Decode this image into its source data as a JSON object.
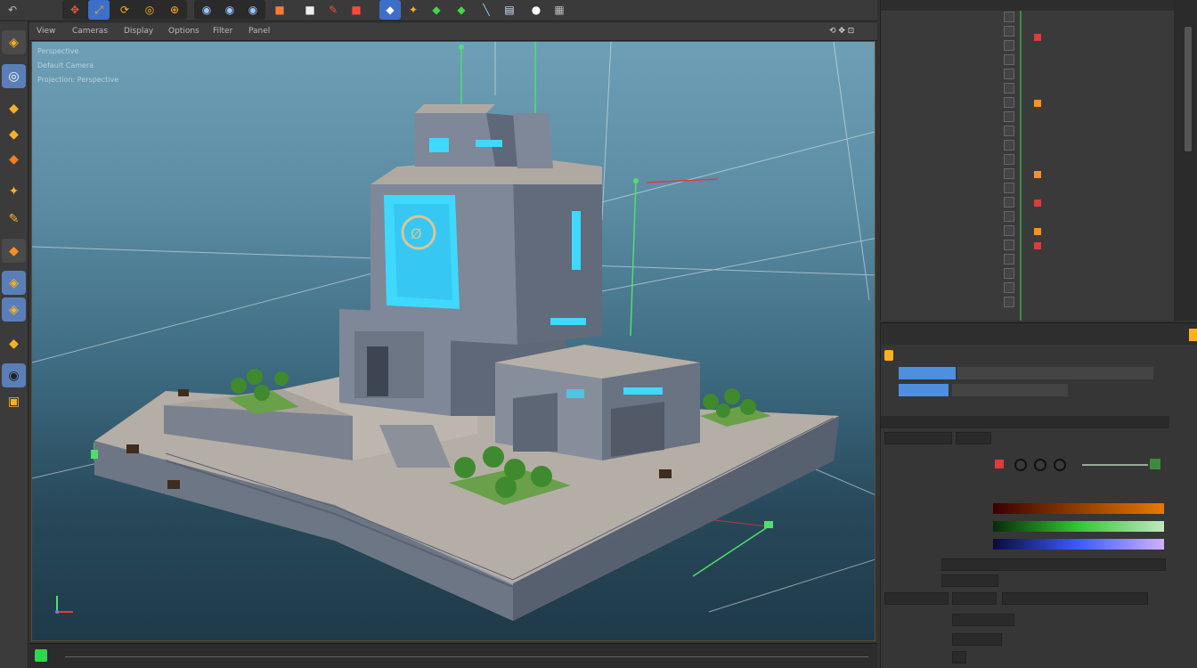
{
  "toolbar": {
    "icons": [
      "undo-icon",
      "move-tool-icon",
      "scale-tool-icon",
      "rotate-tool-icon",
      "add-object-icon",
      "render-view-icon",
      "render-picture-icon",
      "render-settings-icon",
      "record-icon",
      "cube-primitive-icon",
      "spline-pen-icon",
      "generator-icon",
      "deformer-icon",
      "camera-icon",
      "light-icon",
      "material-icon",
      "sculpt-icon"
    ]
  },
  "left_tools": [
    "make-editable-icon",
    "texture-mode-icon",
    "points-mode-icon",
    "edges-mode-icon",
    "polygons-mode-icon",
    "model-mode-icon",
    "axis-mode-icon",
    "snap-icon",
    "workplane-icon",
    "locked-workplane-icon",
    "solo-icon",
    "soft-selection-icon",
    "viewport-solo-icon",
    "render-region-icon",
    "python-icon"
  ],
  "viewport": {
    "menus": [
      "View",
      "Cameras",
      "Display",
      "Options",
      "Filter",
      "Panel"
    ],
    "hud_lines": [
      "Perspective",
      "Default Camera",
      "Projection: Perspective"
    ],
    "colors": {
      "sky_top": "#6e9fb6",
      "sky_bottom": "#1f3a49",
      "accent": "#35d8ff",
      "stone": "#7e8898"
    }
  },
  "object_manager": {
    "colors": {
      "header": "#3a3a3a",
      "active": "#3e8a3e"
    }
  },
  "attributes": {
    "colors": {
      "gradient_red": "#e67a00",
      "gradient_green": "#34c534",
      "gradient_blue": "#3a5cff"
    }
  }
}
